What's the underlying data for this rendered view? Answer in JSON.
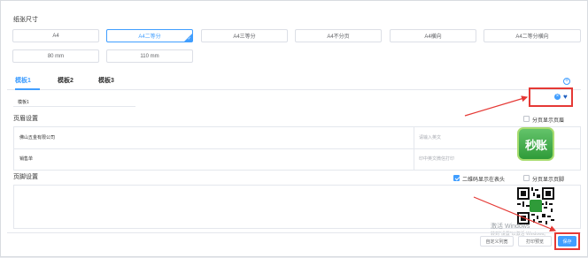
{
  "paper_size": {
    "title": "纸张尺寸",
    "options": [
      "A4",
      "A4二等分",
      "A4三等分",
      "A4不分页",
      "A4横向",
      "A4二等分横向",
      "80 mm",
      "110 mm"
    ],
    "selected": "A4二等分"
  },
  "tabs": [
    "模板1",
    "模板2",
    "模板3"
  ],
  "active_tab": "模板1",
  "template_name_value": "模板1",
  "header_settings": {
    "title": "页眉设置",
    "checkbox_label": "分页显示页眉",
    "company_value": "佛山五金有限公司",
    "company_placeholder": "请输入英文",
    "sale_value": "销售单",
    "sale_placeholder": "印中英文微信打印"
  },
  "footer_settings": {
    "title": "页脚设置",
    "qr_checkbox_label": "二维码显示在表头",
    "qr_checked": true,
    "paging_checkbox_label": "分页显示页脚"
  },
  "logo_text": "秒账",
  "watermark": {
    "line1": "激活 Windows",
    "line2": "转到\"设置\"以激活 Windows。"
  },
  "buttons": {
    "custom_columns": "自定义列宽",
    "print_preview": "打印预览",
    "save": "保存"
  },
  "colors": {
    "accent": "#409eff",
    "highlight": "#e53935"
  },
  "icons": [
    "add-circle-icon",
    "close-circle-icon",
    "heart-icon",
    "check-icon"
  ]
}
